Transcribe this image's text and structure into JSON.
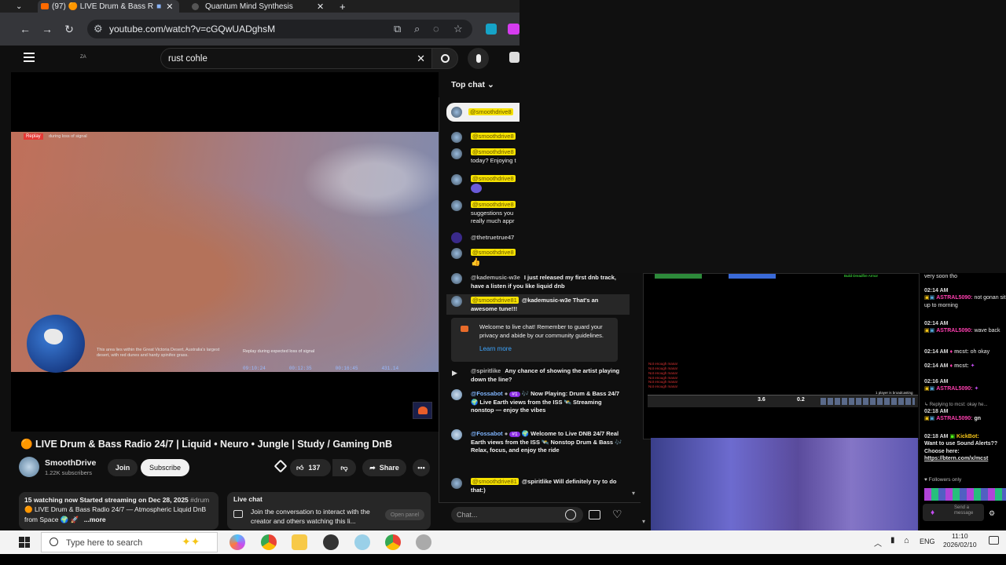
{
  "browser": {
    "tabs": [
      {
        "label": "(97) 🟠 LIVE Drum & Bass R"
      },
      {
        "label": "Quantum Mind Synthesis"
      }
    ],
    "new_tab": "+",
    "url": "youtube.com/watch?v=cGQwUADghsM"
  },
  "youtube": {
    "menu_icon": "hamburger-icon",
    "country_code": "ZA",
    "search_value": "rust cohle"
  },
  "video": {
    "replay_tag": "Replay",
    "replay_note": "during loss of signal",
    "desert_caption": "This area lies within the Great Victoria Desert, Australia's largest desert, with red dunes and hardy spinifex grass.",
    "expected_loss": "Replay during expected loss of signal",
    "stats": [
      "09:10:24",
      "00:12:35",
      "00:16:45",
      "431.14"
    ]
  },
  "info": {
    "title": "🟠 LIVE Drum & Bass Radio 24/7 | Liquid • Neuro • Jungle | Study / Gaming DnB",
    "channel": "SmoothDrive",
    "subscribers": "1.22K subscribers",
    "join": "Join",
    "subscribe": "Subscribe",
    "likes": "137",
    "share": "Share",
    "description_line1": "15 watching now  Started streaming on Dec 28, 2025",
    "description_hash": "#drum",
    "description_line2": "🟠 LIVE Drum & Bass Radio 24/7 — Atmospheric Liquid DnB",
    "description_line3": "from Space 🌍 🚀",
    "more": "...more",
    "live_chat_title": "Live chat",
    "live_chat_prompt": "Join the conversation to interact with the creator and others watching this li...",
    "open_panel": "Open panel"
  },
  "chat": {
    "header": "Top chat",
    "hl_user": "@smoothdrive8",
    "hl_user_full": "@smoothdrive81",
    "line_today": "today? Enjoying t",
    "line_suggest1": "suggestions you",
    "line_suggest2": "really much appr",
    "truetrue": "@thetruetrue47",
    "kade_name": "@kademusic-w3e",
    "kade_msg": "I just released my first dnb track, have a listen if you like liquid dnb",
    "reply1": "@kademusic-w3e That's an awesome tune!!!",
    "welcome": "Welcome to live chat! Remember to guard your privacy and abide by our community guidelines.",
    "learn_more": "Learn more",
    "spirit_name": "@spiritlike",
    "spirit_msg": "Any chance of showing the artist playing down the line?",
    "fossa_name": "@Fossabot",
    "fossa_badge": "#1",
    "fossa_msg1": "🎶 Now Playing: Drum & Bass 24/7 🌍 Live Earth views from the ISS 🛰️ Streaming nonstop — enjoy the vibes",
    "fossa_msg2": "🌍 Welcome to Live DNB 24/7 Real Earth views from the ISS 🛰️ Nonstop Drum & Bass 🎶 Relax, focus, and enjoy the ride",
    "reply2": "@spiritlike Will definitely try to do that:)",
    "input_placeholder": "Chat..."
  },
  "game": {
    "log_line": "Not enough mana!",
    "scores": [
      "3.6",
      "0.2"
    ],
    "ticker": "1 player is broadcasting"
  },
  "rightchat": {
    "line0": "very soon tho",
    "entries": [
      {
        "time": "02:14 AM",
        "user": "ASTRAL5090:",
        "msg": "not gonan sit up to morning"
      },
      {
        "time": "02:14 AM",
        "user": "ASTRAL5090:",
        "msg": "wave back"
      },
      {
        "time": "02:14 AM",
        "user": "mcst:",
        "msg": "oh okay"
      },
      {
        "time": "02:14 AM",
        "user": "mcst:",
        "msg": ""
      },
      {
        "time": "02:16 AM",
        "user": "ASTRAL5090:",
        "msg": ""
      }
    ],
    "replying": "Replying to mcst: okay he...",
    "gn_time": "02:18 AM",
    "gn_user": "ASTRAL5090:",
    "gn_msg": "gn",
    "kick_time": "02:18 AM",
    "kick_user": "KickBot:",
    "kick_msg": "Want to use Sound Alerts?? Choose here:",
    "kick_link": "https://btern.com/x/mcst",
    "followers": "Followers only",
    "send": "Send a message"
  },
  "taskbar": {
    "search_placeholder": "Type here to search",
    "lang": "ENG",
    "time": "11:10",
    "date": "2026/02/10"
  },
  "colors": {
    "yt_red": "#ff0000",
    "highlight": "#f5e100",
    "kick_green": "#53fc18"
  }
}
